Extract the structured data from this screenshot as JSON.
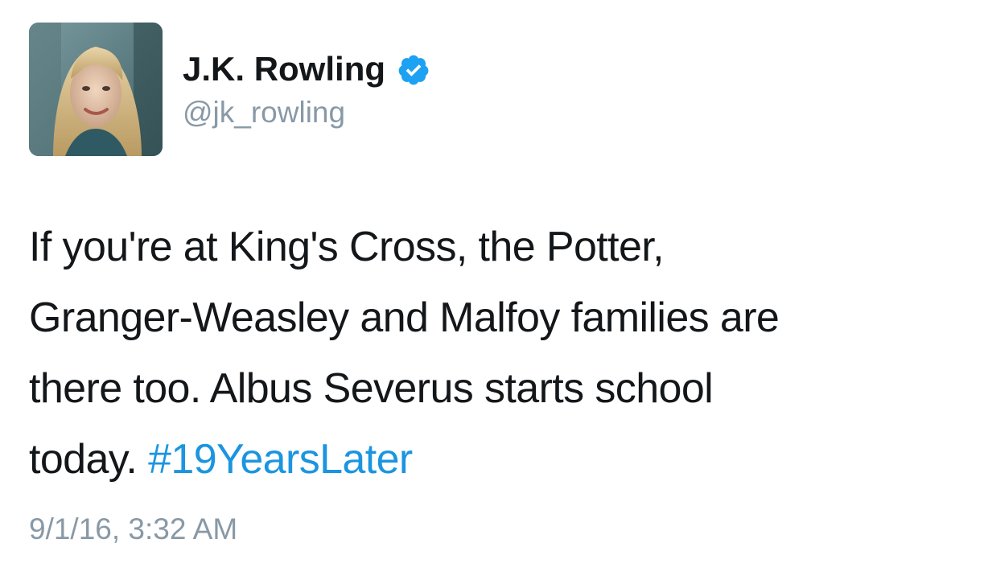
{
  "author": {
    "display_name": "J.K. Rowling",
    "handle": "@jk_rowling",
    "verified": true,
    "avatar_icon": "profile-photo",
    "verified_icon": "verified-badge-icon"
  },
  "tweet": {
    "lines": [
      "If you're at King's Cross, the Potter,",
      "Granger-Weasley and Malfoy families are",
      "there too. Albus Severus starts school",
      "today."
    ],
    "hashtag": "#19YearsLater",
    "timestamp": "9/1/16, 3:32 AM"
  },
  "colors": {
    "text": "#14171a",
    "secondary": "#8899a6",
    "link": "#1b95e0",
    "verified": "#1da1f2"
  }
}
